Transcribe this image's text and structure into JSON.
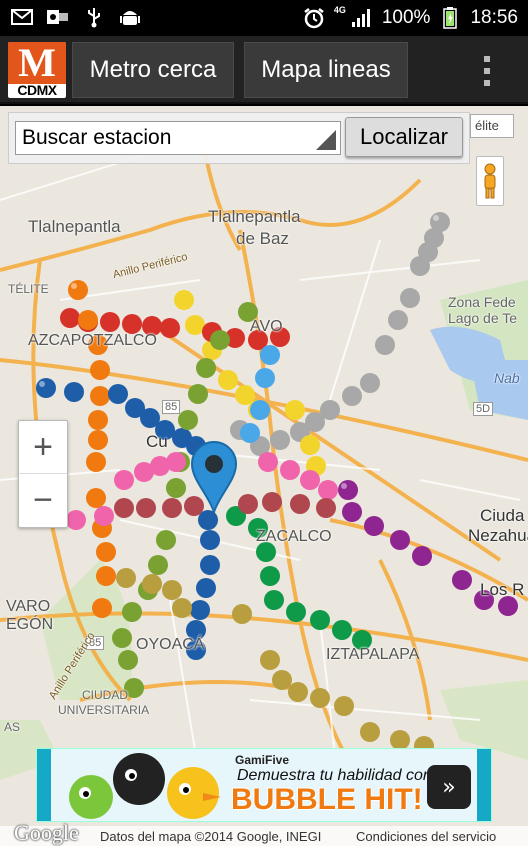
{
  "status_bar": {
    "network": "4G",
    "battery": "100%",
    "time": "18:56",
    "icons": [
      "gmail-icon",
      "outlook-icon",
      "usb-icon",
      "android-icon",
      "alarm-icon",
      "signal-icon",
      "battery-icon"
    ]
  },
  "action_bar": {
    "logo_text": "CDMX",
    "logo_letter": "M",
    "buttons": [
      "Metro cerca",
      "Mapa lineas"
    ],
    "accent": "#e2561b"
  },
  "search": {
    "select_value": "Buscar estacion",
    "button_label": "Localizar",
    "satellite_label": "élite"
  },
  "map": {
    "zoom_in": "+",
    "zoom_out": "−",
    "labels": {
      "tlalnepantla": "Tlalnepantla",
      "tlalnepantla_baz_1": "Tlalnepantla",
      "tlalnepantla_baz_2": "de Baz",
      "anillo_periferico_top": "Anillo Periférico",
      "azcapotzalco": "AZCAPOTZALCO",
      "zona_federal_1": "Zona Fede",
      "zona_federal_2": "Lago de Te",
      "nab": "Nab",
      "ciudad_neza_1": "Ciuda",
      "ciudad_neza_2": "Nezahua",
      "los_r": "Los R",
      "zacalco": "ZACALCO",
      "iztapalapa": "IZTAPALAPA",
      "varo": "VARO",
      "egon": "EGÓN",
      "coyoacan": "OYOACÁ",
      "ciudad_univ_1": "CIUDAD",
      "ciudad_univ_2": "UNIVERSITARIA",
      "anillo_periferico_left": "Anillo Periférico",
      "telite_left": "TÉLITE",
      "gustavo": "AVO",
      "road_85a": "85",
      "road_85b": "85",
      "road_5d": "5D",
      "cu_label": "Cu",
      "las": "AS"
    }
  },
  "ad": {
    "brand": "GamiFive",
    "tagline": "Demuestra tu habilidad con",
    "headline": "BUBBLE HIT!",
    "play_icon": "»"
  },
  "footer": {
    "logo": "Google",
    "credit": "Datos del mapa ©2014 Google, INEGI",
    "terms": "Condiciones del servicio"
  },
  "metro_colors": {
    "line1": "#e8679a",
    "line2": "#1e5ea8",
    "line3": "#7aa232",
    "line4": "#6ac4c8",
    "line5": "#f3d42d",
    "line6": "#d6322a",
    "line7": "#f07a10",
    "line8": "#0e9a48",
    "line9": "#6d3b1a",
    "lineA": "#8e2590",
    "lineB": "#a8a8a8",
    "line12": "#b99e3f"
  }
}
